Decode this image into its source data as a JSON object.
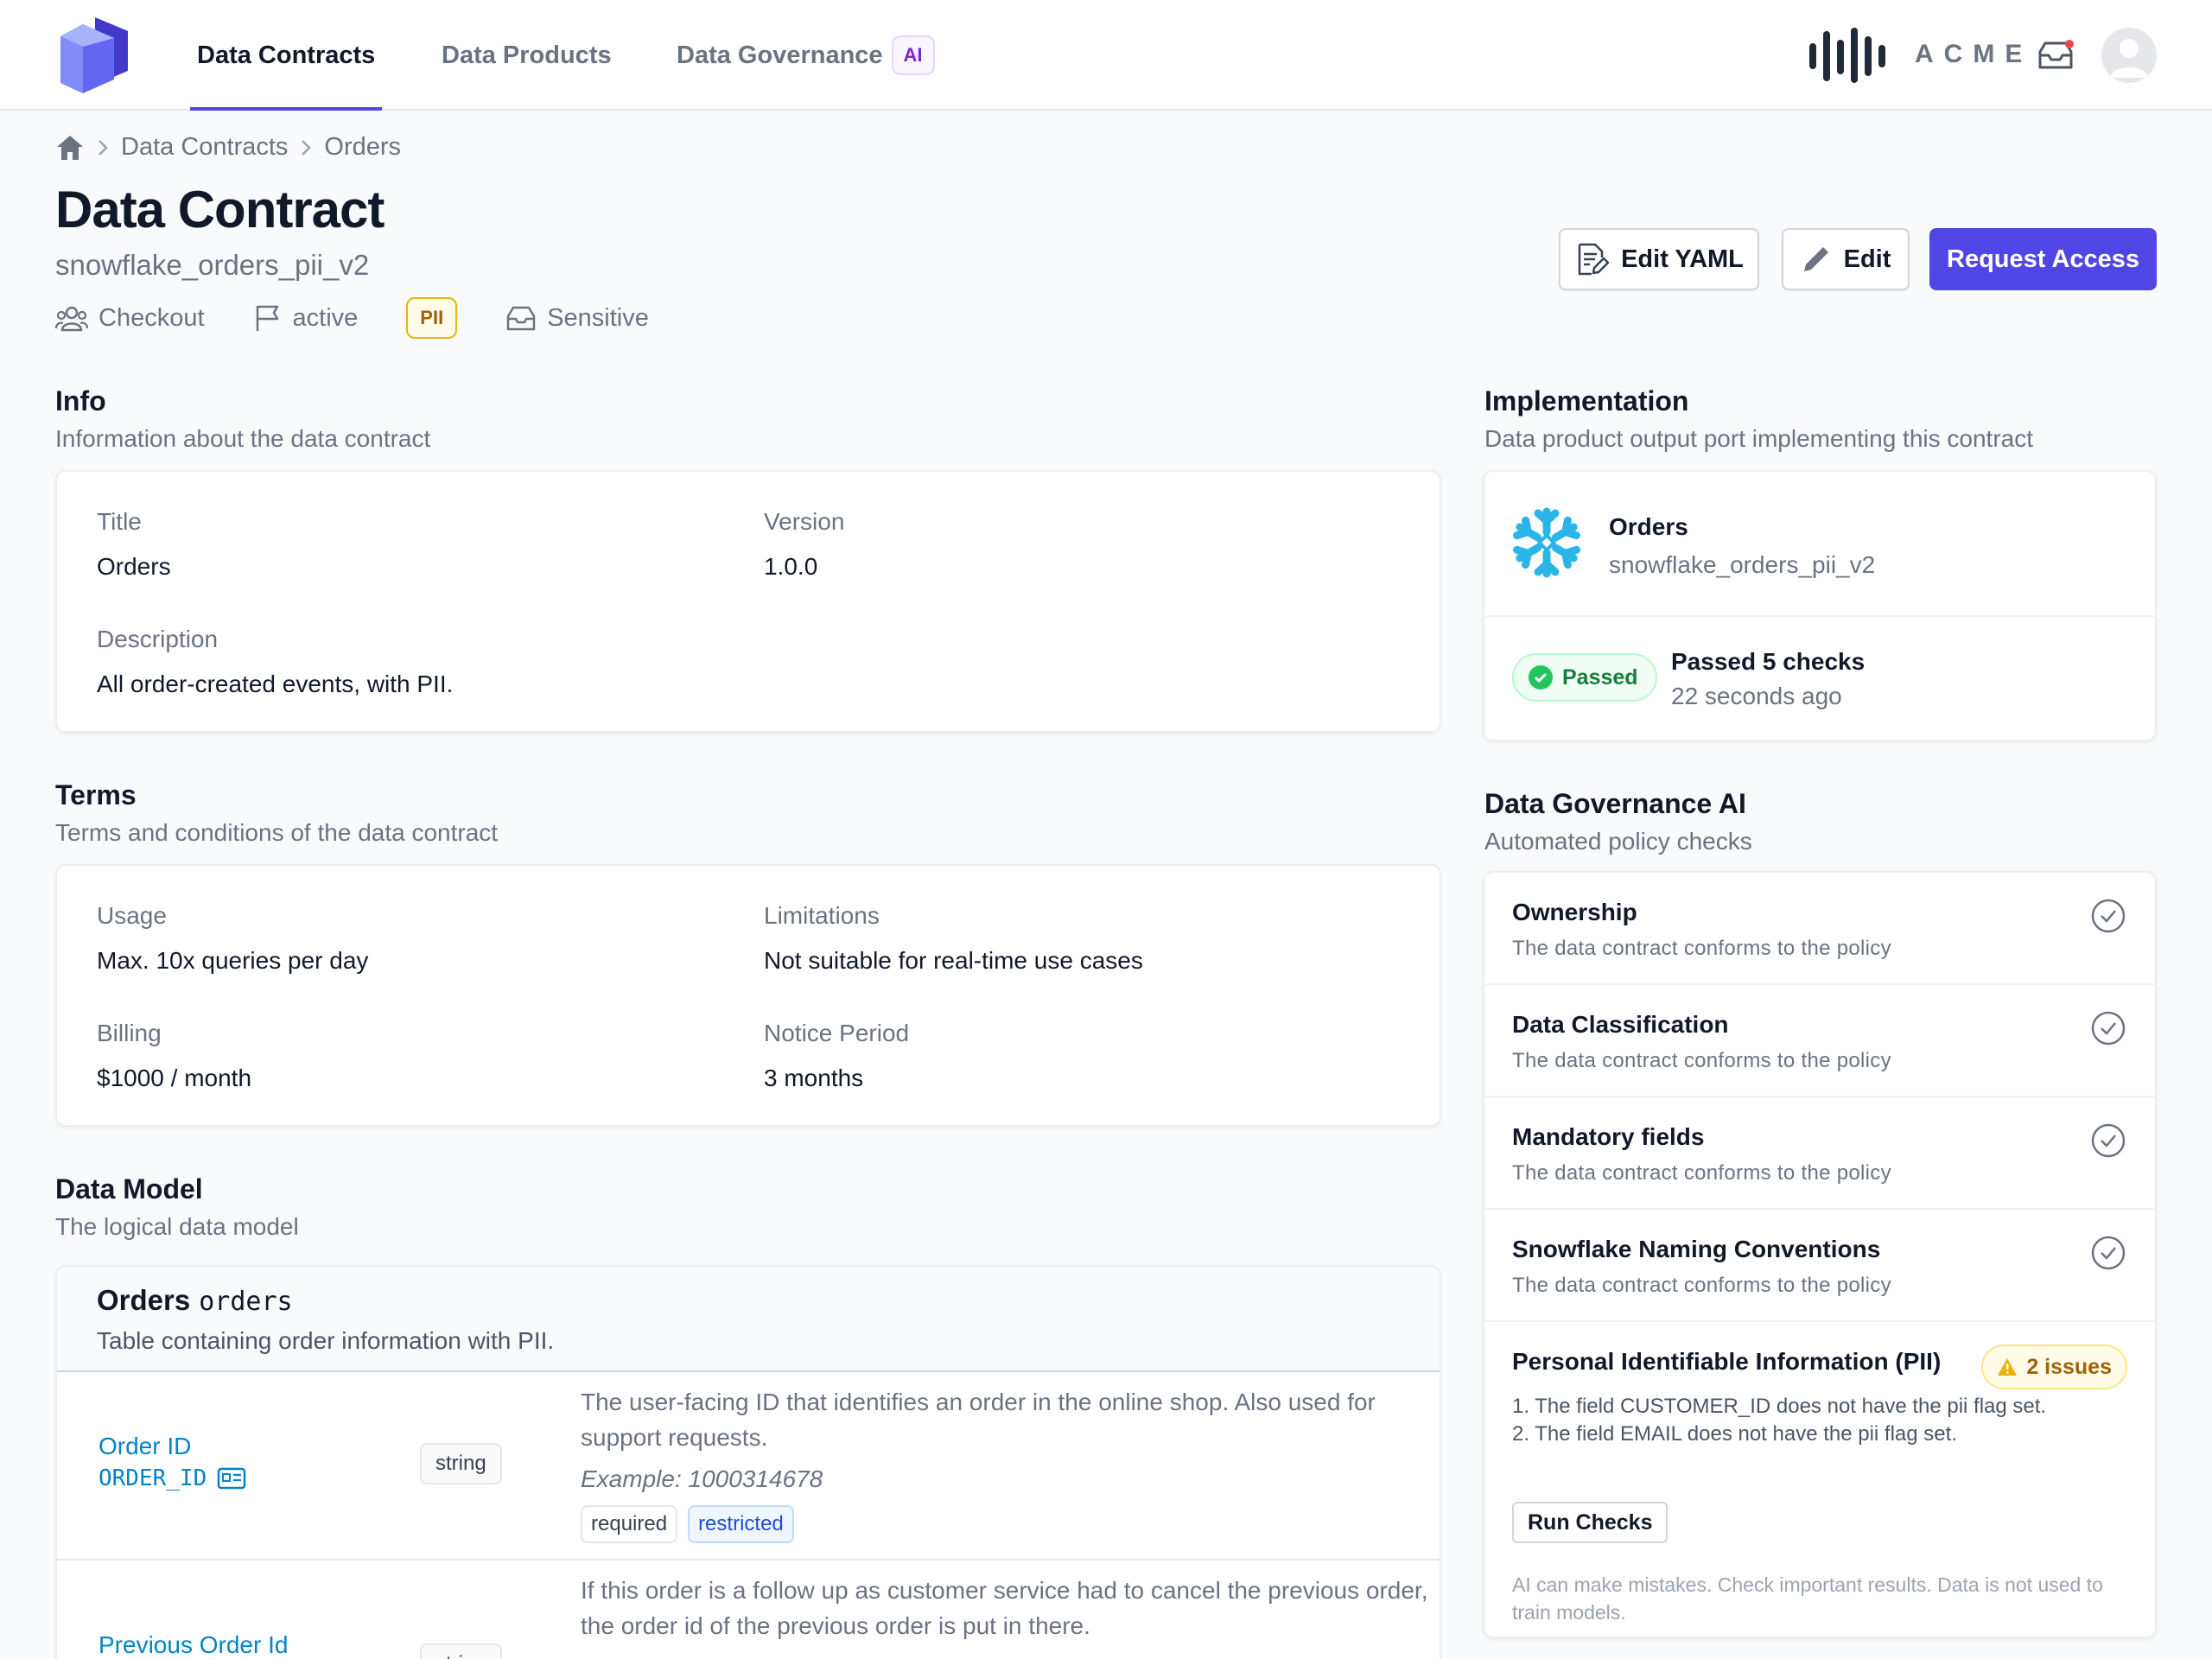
{
  "nav": {
    "tabs": [
      {
        "label": "Data Contracts",
        "active": true
      },
      {
        "label": "Data Products",
        "active": false
      },
      {
        "label": "Data Governance",
        "badge": "AI",
        "active": false
      }
    ],
    "org_name": "ACME",
    "brand_color": "#4f46e5"
  },
  "breadcrumb": {
    "items": [
      "Data Contracts",
      "Orders"
    ]
  },
  "header": {
    "title": "Data Contract",
    "subtitle": "snowflake_orders_pii_v2",
    "meta": {
      "team": "Checkout",
      "status": "active",
      "classification_badge": "PII",
      "sensitivity": "Sensitive"
    },
    "buttons": {
      "edit_yaml": "Edit YAML",
      "edit": "Edit",
      "request_access": "Request Access"
    }
  },
  "info": {
    "title": "Info",
    "description": "Information about the data contract",
    "fields": {
      "title_label": "Title",
      "title_value": "Orders",
      "version_label": "Version",
      "version_value": "1.0.0",
      "description_label": "Description",
      "description_value": "All order-created events, with PII."
    }
  },
  "terms": {
    "title": "Terms",
    "description": "Terms and conditions of the data contract",
    "fields": {
      "usage_label": "Usage",
      "usage_value": "Max. 10x queries per day",
      "limitations_label": "Limitations",
      "limitations_value": "Not suitable for real-time use cases",
      "billing_label": "Billing",
      "billing_value": "$1000 / month",
      "notice_label": "Notice Period",
      "notice_value": "3 months"
    }
  },
  "data_model": {
    "title": "Data Model",
    "description": "The logical data model",
    "table": {
      "title": "Orders",
      "physical_name": "orders",
      "description": "Table containing order information with PII."
    },
    "fields": [
      {
        "title": "Order ID",
        "name": "ORDER_ID",
        "type": "string",
        "description": "The user-facing ID that identifies an order in the online shop. Also used for support requests.",
        "example": "Example: 1000314678",
        "tags": [
          "required",
          "restricted"
        ]
      },
      {
        "title": "Previous Order Id",
        "type": "string",
        "description": "If this order is a follow up as customer service had to cancel the previous order, the order id of the previous order is put in there."
      }
    ]
  },
  "implementation": {
    "title": "Implementation",
    "description": "Data product output port implementing this contract",
    "port_name": "Orders",
    "port_id": "snowflake_orders_pii_v2",
    "status": "Passed",
    "checks_text": "Passed 5 checks",
    "checks_time": "22 seconds ago"
  },
  "governance": {
    "title": "Data Governance AI",
    "description": "Automated policy checks",
    "policies": [
      {
        "name": "Ownership",
        "result": "The data contract conforms to the policy"
      },
      {
        "name": "Data Classification",
        "result": "The data contract conforms to the policy"
      },
      {
        "name": "Mandatory fields",
        "result": "The data contract conforms to the policy"
      },
      {
        "name": "Snowflake Naming Conventions",
        "result": "The data contract conforms to the policy"
      }
    ],
    "pii": {
      "name": "Personal Identifiable Information (PII)",
      "issues_badge": "2 issues",
      "issues": [
        "1. The field CUSTOMER_ID does not have the pii flag set.",
        "2. The field EMAIL does not have the pii flag set."
      ]
    },
    "run_checks": "Run Checks",
    "disclaimer": "AI can make mistakes. Check important results. Data is not used to train models."
  }
}
